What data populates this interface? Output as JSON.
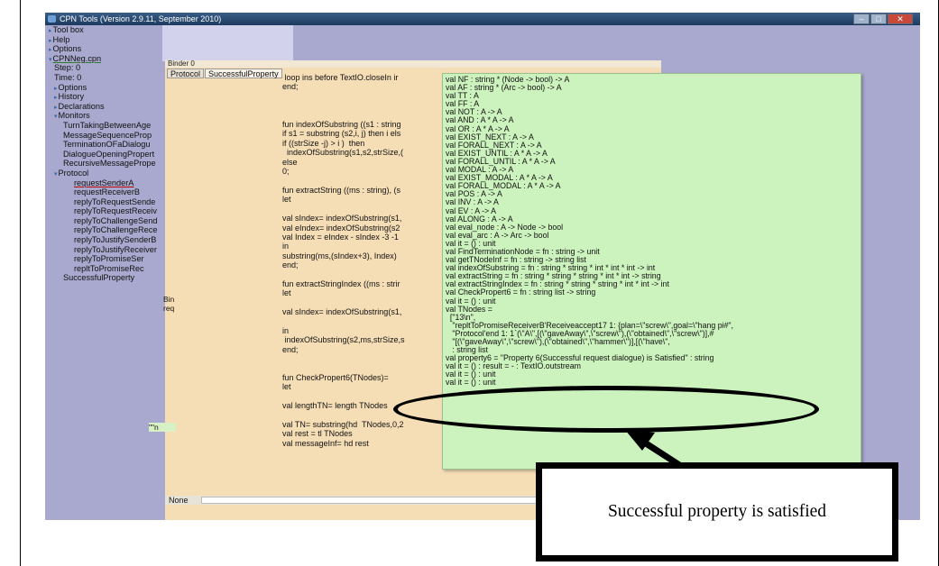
{
  "window": {
    "title": "CPN Tools (Version 2.9.11, September 2010)",
    "minimize_glyph": "–",
    "maximize_glyph": "□",
    "close_glyph": "✕"
  },
  "index": {
    "items": [
      {
        "label": "Tool box",
        "level": 0,
        "arrow": "▸"
      },
      {
        "label": "Help",
        "level": 0,
        "arrow": "▸"
      },
      {
        "label": "Options",
        "level": 0,
        "arrow": "▸"
      },
      {
        "label": "CPNNeg.cpn",
        "level": 0,
        "arrow": "▾",
        "style": "ul"
      },
      {
        "label": "Step: 0",
        "level": 1,
        "arrow": ""
      },
      {
        "label": "Time: 0",
        "level": 1,
        "arrow": ""
      },
      {
        "label": "Options",
        "level": 1,
        "arrow": "▸"
      },
      {
        "label": "History",
        "level": 1,
        "arrow": "▸"
      },
      {
        "label": "Declarations",
        "level": 1,
        "arrow": "▸"
      },
      {
        "label": "Monitors",
        "level": 1,
        "arrow": "▾"
      },
      {
        "label": "TurnTakingBetweenAge",
        "level": 2,
        "arrow": ""
      },
      {
        "label": "MessageSequenceProp",
        "level": 2,
        "arrow": ""
      },
      {
        "label": "TerminationOFaDialogu",
        "level": 2,
        "arrow": ""
      },
      {
        "label": "DialogueOpeningPropert",
        "level": 2,
        "arrow": ""
      },
      {
        "label": "RecursiveMessagePrope",
        "level": 2,
        "arrow": ""
      },
      {
        "label": "Protocol",
        "level": 1,
        "arrow": "▾"
      },
      {
        "label": "requestSenderA",
        "level": 3,
        "arrow": "",
        "style": "ul-red"
      },
      {
        "label": "requestReceiverB",
        "level": 3,
        "arrow": ""
      },
      {
        "label": "replyToRequestSende",
        "level": 3,
        "arrow": ""
      },
      {
        "label": "replyToRequestReceiv",
        "level": 3,
        "arrow": ""
      },
      {
        "label": "replyToChallengeSend",
        "level": 3,
        "arrow": ""
      },
      {
        "label": "replyToChallengeRece",
        "level": 3,
        "arrow": ""
      },
      {
        "label": "replyToJustifySenderB",
        "level": 3,
        "arrow": ""
      },
      {
        "label": "replyToJustifyReceiver",
        "level": 3,
        "arrow": ""
      },
      {
        "label": "replyToPromiseSer",
        "level": 3,
        "arrow": ""
      },
      {
        "label": "repltToPromiseRec",
        "level": 3,
        "arrow": ""
      },
      {
        "label": "SuccessfulProperty",
        "level": 2,
        "arrow": ""
      }
    ]
  },
  "binder": {
    "title": "Binder 0",
    "tabs": [
      "Protocol",
      "SuccessfulProperty"
    ],
    "code": " loop ins before TextIO.closeIn ir\nend;\n\n\n\nfun indexOfSubstring ((s1 : string\nif s1 = substring (s2,i, j) then i els\nif ((strSize -j) > i )  then\n  indexOfSubstring(s1,s2,strSize,(\nelse\n0;\n\nfun extractString ((ms : string), (s\nlet\n\nval sIndex= indexOfSubstring(s1,\nval eIndex= indexOfSubstring(s2\nval Index = eIndex - sIndex -3 -1\nin\nsubstring(ms,(sIndex+3), Index)\nend;\n\nfun extractStringIndex ((ms : strir\nlet\n\nval sIndex= indexOfSubstring(s1,\n\nin\n indexOfSubstring(s2,ms,strSize,s\nend;\n\n\nfun CheckPropert6(TNodes)=\nlet\n\nval lengthTN= length TNodes\n\nval TN= substring(hd  TNodes,0,2\nval rest = tl TNodes\nval messageInf= hd rest",
    "fragment_bin": "Bin\nreq",
    "fragment_n": "\"\"n",
    "none_label": "None"
  },
  "output": {
    "text": "val NF : string * (Node -> bool) -> A\nval AF : string * (Arc -> bool) -> A\nval TT : A\nval FF : A\nval NOT : A -> A\nval AND : A * A -> A\nval OR : A * A -> A\nval EXIST_NEXT : A -> A\nval FORALL_NEXT : A -> A\nval EXIST_UNTIL : A * A -> A\nval FORALL_UNTIL : A * A -> A\nval MODAL : A -> A\nval EXIST_MODAL : A * A -> A\nval FORALL_MODAL : A * A -> A\nval POS : A -> A\nval INV : A -> A\nval EV : A -> A\nval ALONG : A -> A\nval eval_node : A -> Node -> bool\nval eval_arc : A -> Arc -> bool\nval it = () : unit\nval FindTerminationNode = fn : string -> unit\nval getTNodeInf = fn : string -> string list\nval indexOfSubstring = fn : string * string * int * int * int -> int\nval extractString = fn : string * string * string * int * int -> string\nval extractStringIndex = fn : string * string * string * int * int -> int\nval CheckPropert6 = fn : string list -> string\nval it = () : unit\nval TNodes =\n  [\"13\\n\",\n   \"repltToPromiseReceiverB'Receiveaccept17 1: {plan=\\\"screw\\\",goal=\\\"hang pi#\",\n   \"Protocol'end 1: 1`(\\\"A\\\",[(\\\"gaveAway\\\",\\\"screw\\\"),(\\\"obtained\\\",\\\"screw\\\")],#\n   \"[(\\\"gaveAway\\\",\\\"screw\\\"),(\\\"obtained\\\",\\\"hammer\\\")],[(\\\"have\\\",\n   : string list\nval property6 = \"Property 6(Successful request dialogue) is Satisfied\" : string\nval it = () : result = - : TextIO.outstream\nval it = () : unit\nval it = () : unit"
  },
  "annotation": {
    "note": "Successful property is satisfied"
  }
}
